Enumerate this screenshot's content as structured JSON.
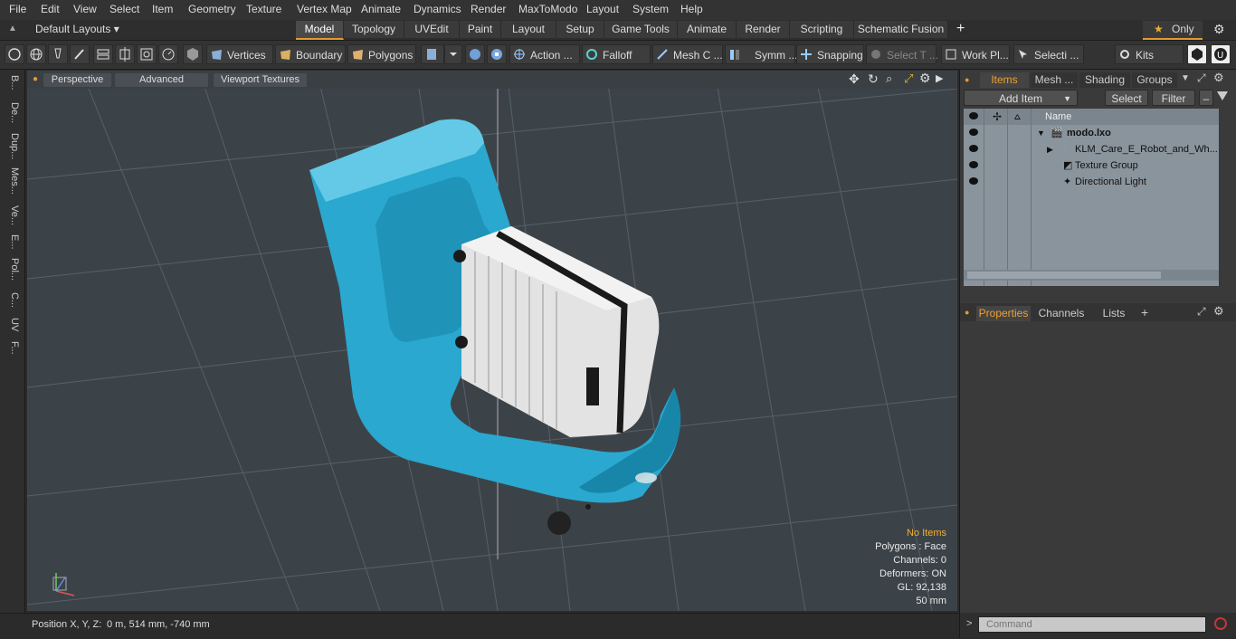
{
  "menu": [
    "File",
    "Edit",
    "View",
    "Select",
    "Item",
    "Geometry",
    "Texture",
    "Vertex Map",
    "Animate",
    "Dynamics",
    "Render",
    "MaxToModo",
    "Layout",
    "System",
    "Help"
  ],
  "layout_selector": "Default Layouts ▾",
  "tabs": [
    "Model",
    "Topology",
    "UVEdit",
    "Paint",
    "Layout",
    "Setup",
    "Game Tools",
    "Animate",
    "Render",
    "Scripting",
    "Schematic Fusion"
  ],
  "tab_add": "+",
  "only_label": "Only",
  "toolbar": {
    "vertices": "Vertices",
    "boundary": "Boundary",
    "polygons": "Polygons",
    "action": "Action ...",
    "falloff": "Falloff",
    "mesh": "Mesh C ...",
    "symm": "Symm ...",
    "snapping": "Snapping",
    "select_t": "Select T ...",
    "workpl": "Work Pl...",
    "selecti": "Selecti ...",
    "kits": "Kits"
  },
  "left_tabs": [
    "B...",
    "De...",
    "Dup...",
    "Mes...",
    "Ve...",
    "E...",
    "Pol...",
    "C...",
    "UV",
    "F..."
  ],
  "viewport": {
    "perspective": "Perspective",
    "advanced": "Advanced",
    "viewport_textures": "Viewport Textures",
    "info": {
      "no_items": "No Items",
      "polygons": "Polygons : Face",
      "channels": "Channels: 0",
      "deformers": "Deformers: ON",
      "gl": "GL: 92,138",
      "scale": "50 mm"
    }
  },
  "status": {
    "position_label": "Position X, Y, Z:",
    "position_value": "0 m, 514 mm, -740 mm"
  },
  "right_panel": {
    "tabs": [
      "Items",
      "Mesh ...",
      "Shading",
      "Groups"
    ],
    "add_item": "Add Item",
    "select": "Select",
    "filter": "Filter",
    "name_header": "Name",
    "items": [
      "modo.lxo",
      "KLM_Care_E_Robot_and_Wh...",
      "Texture Group",
      "Directional Light"
    ],
    "prop_tabs": [
      "Properties",
      "Channels",
      "Lists"
    ],
    "prop_add": "+",
    "command_placeholder": "Command"
  },
  "colors": {
    "accent": "#e39b2f",
    "robot": "#2aa8cf",
    "suitcase": "#e3e3e3",
    "viewport_bg": "#3c4348"
  }
}
